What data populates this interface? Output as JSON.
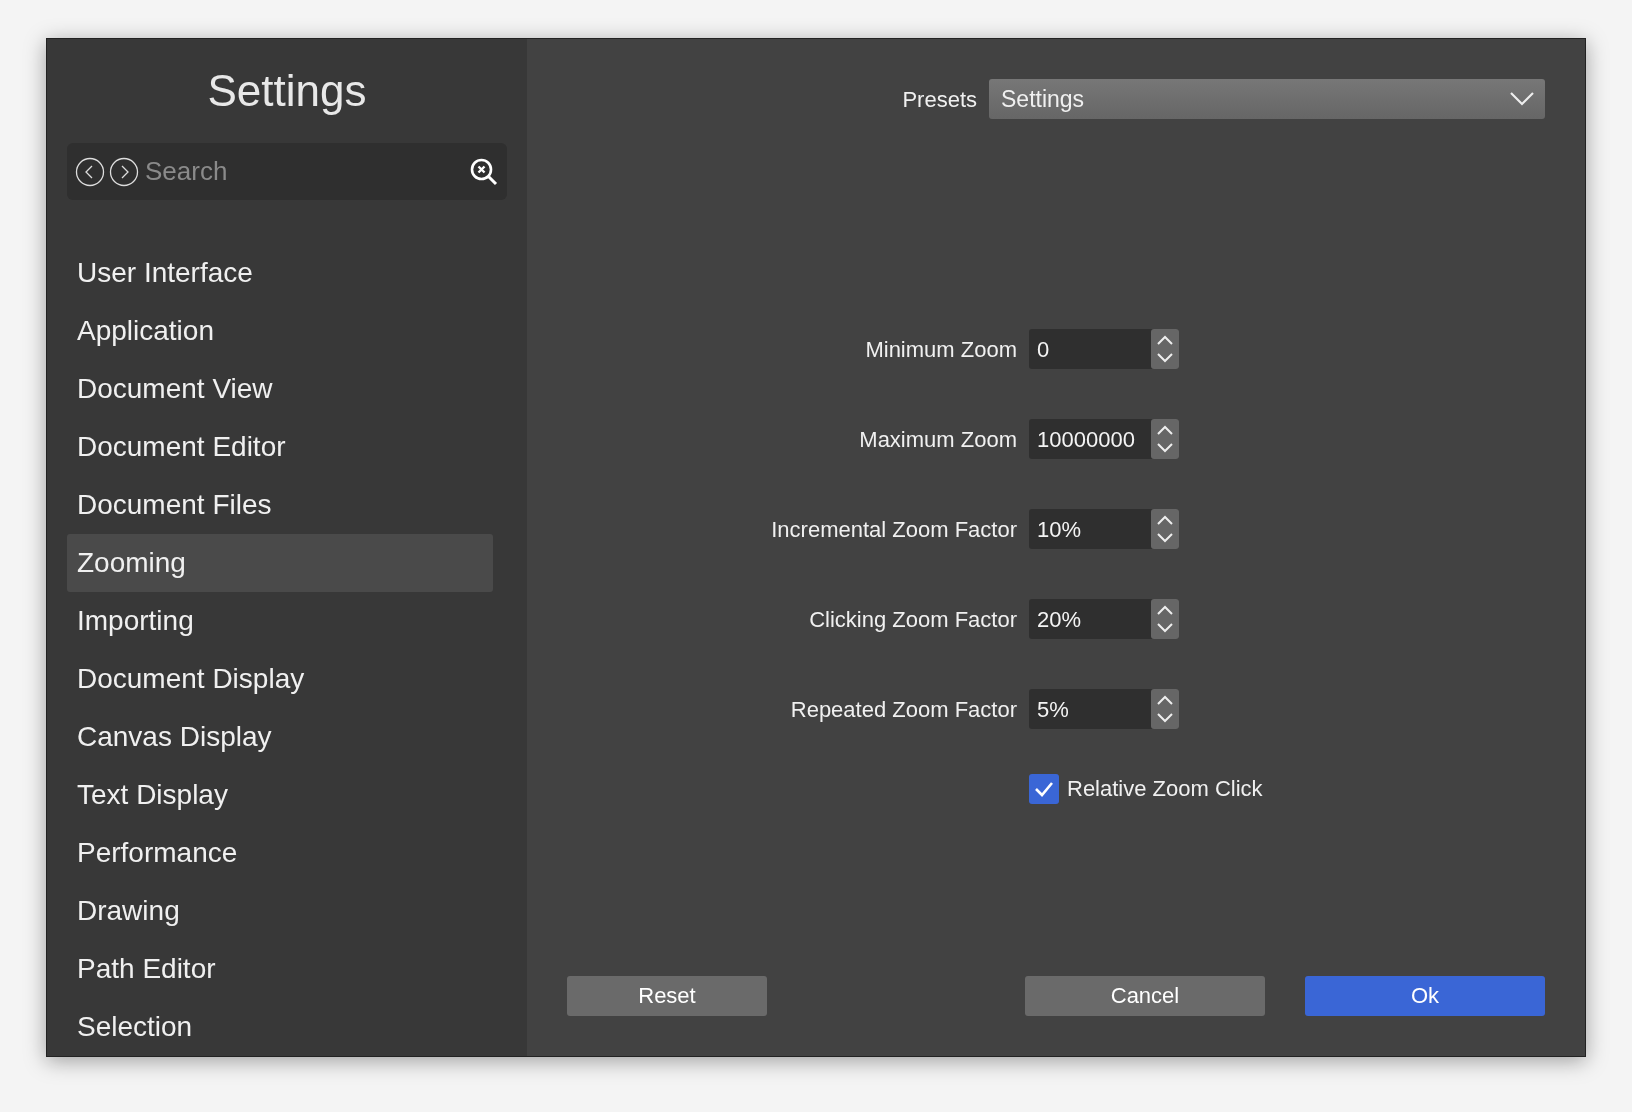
{
  "window": {
    "title": "Settings"
  },
  "search": {
    "placeholder": "Search"
  },
  "sidebar": {
    "items": [
      {
        "label": "User Interface",
        "selected": false
      },
      {
        "label": "Application",
        "selected": false
      },
      {
        "label": "Document View",
        "selected": false
      },
      {
        "label": "Document Editor",
        "selected": false
      },
      {
        "label": "Document Files",
        "selected": false
      },
      {
        "label": "Zooming",
        "selected": true
      },
      {
        "label": "Importing",
        "selected": false
      },
      {
        "label": "Document Display",
        "selected": false
      },
      {
        "label": "Canvas Display",
        "selected": false
      },
      {
        "label": "Text Display",
        "selected": false
      },
      {
        "label": "Performance",
        "selected": false
      },
      {
        "label": "Drawing",
        "selected": false
      },
      {
        "label": "Path Editor",
        "selected": false
      },
      {
        "label": "Selection",
        "selected": false
      }
    ]
  },
  "presets": {
    "label": "Presets",
    "value": "Settings"
  },
  "fields": [
    {
      "label": "Minimum Zoom",
      "value": "0"
    },
    {
      "label": "Maximum Zoom",
      "value": "10000000"
    },
    {
      "label": "Incremental Zoom Factor",
      "value": "10%"
    },
    {
      "label": "Clicking Zoom Factor",
      "value": "20%"
    },
    {
      "label": "Repeated Zoom Factor",
      "value": "5%"
    }
  ],
  "checkbox": {
    "label": "Relative Zoom Click",
    "checked": true
  },
  "buttons": [
    {
      "label": "Reset",
      "kind": "secondary"
    },
    {
      "label": "Cancel",
      "kind": "secondary"
    },
    {
      "label": "Ok",
      "kind": "primary"
    }
  ]
}
